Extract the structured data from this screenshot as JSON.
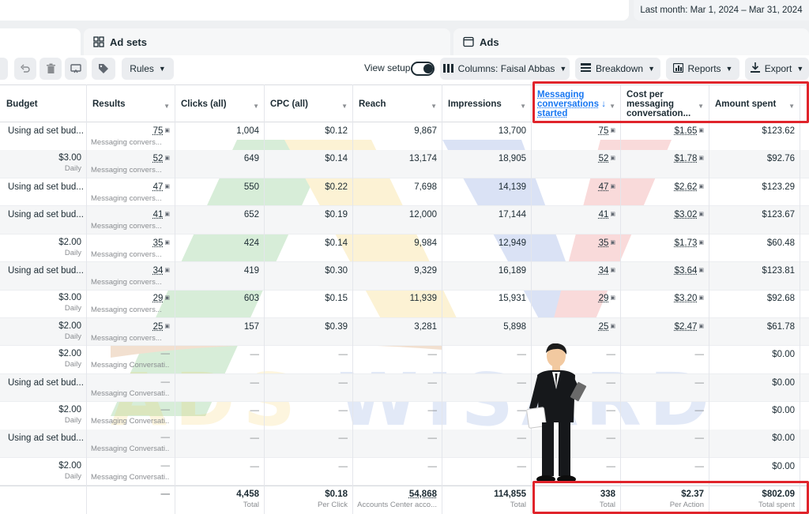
{
  "date_range": "Last month: Mar 1, 2024 – Mar 31, 2024",
  "tabs": [
    {
      "label": "Ad sets",
      "icon": "grid-icon"
    },
    {
      "label": "Ads",
      "icon": "ad-window-icon"
    }
  ],
  "toolbar": {
    "rules_label": "Rules",
    "view_setup_label": "View setup",
    "columns_label": "Columns: Faisal Abbas",
    "breakdown_label": "Breakdown",
    "reports_label": "Reports",
    "export_label": "Export"
  },
  "columns": [
    "Budget",
    "Results",
    "Clicks (all)",
    "CPC (all)",
    "Reach",
    "Impressions",
    "Messaging conversations started",
    "Cost per messaging conversation...",
    "Amount spent"
  ],
  "rows": [
    {
      "budget": "Using ad set bud...",
      "budget_sub": "",
      "results": "75",
      "results_sub": "Messaging convers...",
      "clicks": "1,004",
      "cpc": "$0.12",
      "reach": "9,867",
      "impressions": "13,700",
      "msg": "75",
      "cost": "$1.65",
      "spent": "$123.62"
    },
    {
      "budget": "$3.00",
      "budget_sub": "Daily",
      "results": "52",
      "results_sub": "Messaging convers...",
      "clicks": "649",
      "cpc": "$0.14",
      "reach": "13,174",
      "impressions": "18,905",
      "msg": "52",
      "cost": "$1.78",
      "spent": "$92.76"
    },
    {
      "budget": "Using ad set bud...",
      "budget_sub": "",
      "results": "47",
      "results_sub": "Messaging convers...",
      "clicks": "550",
      "cpc": "$0.22",
      "reach": "7,698",
      "impressions": "14,139",
      "msg": "47",
      "cost": "$2.62",
      "spent": "$123.29"
    },
    {
      "budget": "Using ad set bud...",
      "budget_sub": "",
      "results": "41",
      "results_sub": "Messaging convers...",
      "clicks": "652",
      "cpc": "$0.19",
      "reach": "12,000",
      "impressions": "17,144",
      "msg": "41",
      "cost": "$3.02",
      "spent": "$123.67"
    },
    {
      "budget": "$2.00",
      "budget_sub": "Daily",
      "results": "35",
      "results_sub": "Messaging convers...",
      "clicks": "424",
      "cpc": "$0.14",
      "reach": "9,984",
      "impressions": "12,949",
      "msg": "35",
      "cost": "$1.73",
      "spent": "$60.48"
    },
    {
      "budget": "Using ad set bud...",
      "budget_sub": "",
      "results": "34",
      "results_sub": "Messaging convers...",
      "clicks": "419",
      "cpc": "$0.30",
      "reach": "9,329",
      "impressions": "16,189",
      "msg": "34",
      "cost": "$3.64",
      "spent": "$123.81"
    },
    {
      "budget": "$3.00",
      "budget_sub": "Daily",
      "results": "29",
      "results_sub": "Messaging convers...",
      "clicks": "603",
      "cpc": "$0.15",
      "reach": "11,939",
      "impressions": "15,931",
      "msg": "29",
      "cost": "$3.20",
      "spent": "$92.68"
    },
    {
      "budget": "$2.00",
      "budget_sub": "Daily",
      "results": "25",
      "results_sub": "Messaging convers...",
      "clicks": "157",
      "cpc": "$0.39",
      "reach": "3,281",
      "impressions": "5,898",
      "msg": "25",
      "cost": "$2.47",
      "spent": "$61.78"
    },
    {
      "budget": "$2.00",
      "budget_sub": "Daily",
      "results": "—",
      "results_sub": "Messaging Conversati...",
      "clicks": "—",
      "cpc": "—",
      "reach": "—",
      "impressions": "—",
      "msg": "—",
      "cost": "—",
      "spent": "$0.00"
    },
    {
      "budget": "Using ad set bud...",
      "budget_sub": "",
      "results": "—",
      "results_sub": "Messaging Conversati...",
      "clicks": "—",
      "cpc": "—",
      "reach": "—",
      "impressions": "—",
      "msg": "—",
      "cost": "—",
      "spent": "$0.00"
    },
    {
      "budget": "$2.00",
      "budget_sub": "Daily",
      "results": "—",
      "results_sub": "Messaging Conversati...",
      "clicks": "—",
      "cpc": "—",
      "reach": "—",
      "impressions": "—",
      "msg": "—",
      "cost": "—",
      "spent": "$0.00"
    },
    {
      "budget": "Using ad set bud...",
      "budget_sub": "",
      "results": "—",
      "results_sub": "Messaging Conversati...",
      "clicks": "—",
      "cpc": "—",
      "reach": "—",
      "impressions": "—",
      "msg": "—",
      "cost": "—",
      "spent": "$0.00"
    },
    {
      "budget": "$2.00",
      "budget_sub": "Daily",
      "results": "—",
      "results_sub": "Messaging Conversati...",
      "clicks": "—",
      "cpc": "—",
      "reach": "—",
      "impressions": "—",
      "msg": "—",
      "cost": "—",
      "spent": "$0.00"
    }
  ],
  "totals": {
    "results": "—",
    "clicks": "4,458",
    "clicks_sub": "Total",
    "cpc": "$0.18",
    "cpc_sub": "Per Click",
    "reach": "54,868",
    "reach_sub": "Accounts Center acco...",
    "impressions": "114,855",
    "impressions_sub": "Total",
    "msg": "338",
    "msg_sub": "Total",
    "cost": "$2.37",
    "cost_sub": "Per Action",
    "spent": "$802.09",
    "spent_sub": "Total spent"
  },
  "watermark": {
    "text": "ADS WISARD",
    "letters": [
      "A",
      "D",
      "S",
      "W",
      "I",
      "S",
      "A",
      "R",
      "D"
    ]
  },
  "colors": {
    "accent": "#1877f2",
    "highlight": "#e0242b",
    "wm_green": "#4caf50",
    "wm_yellow": "#f4c542",
    "wm_blue": "#5b7fd6",
    "wm_red": "#e85a5a"
  }
}
